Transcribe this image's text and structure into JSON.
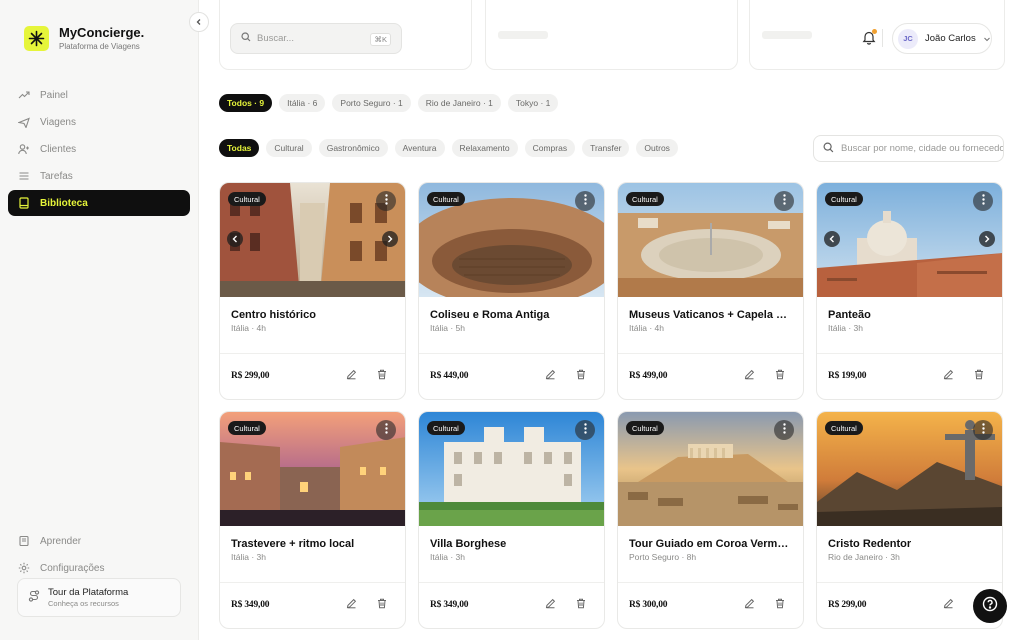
{
  "brand": {
    "name": "MyConcierge.",
    "subtitle": "Plataforma de Viagens"
  },
  "colors": {
    "accent": "#e6f53a",
    "dark": "#0f0f0f"
  },
  "nav": [
    {
      "id": "painel",
      "label": "Painel",
      "icon": "trend-icon"
    },
    {
      "id": "viagens",
      "label": "Viagens",
      "icon": "plane-icon"
    },
    {
      "id": "clientes",
      "label": "Clientes",
      "icon": "user-plus-icon"
    },
    {
      "id": "tarefas",
      "label": "Tarefas",
      "icon": "list-icon"
    },
    {
      "id": "biblioteca",
      "label": "Biblioteca",
      "icon": "book-icon",
      "active": true
    }
  ],
  "bottom_nav": [
    {
      "id": "aprender",
      "label": "Aprender",
      "icon": "book-open-icon"
    },
    {
      "id": "configuracoes",
      "label": "Configurações",
      "icon": "gear-icon"
    }
  ],
  "tour": {
    "title": "Tour da Plataforma",
    "subtitle": "Conheça os recursos"
  },
  "search": {
    "placeholder": "Buscar...",
    "shortcut": "⌘K"
  },
  "user": {
    "initials": "JC",
    "name": "João Carlos"
  },
  "destination_chips": [
    "Todos · 9",
    "Itália · 6",
    "Porto Seguro · 1",
    "Rio de Janeiro · 1",
    "Tokyo · 1"
  ],
  "category_chips": [
    "Todas",
    "Cultural",
    "Gastronômico",
    "Aventura",
    "Relaxamento",
    "Compras",
    "Transfer",
    "Outros"
  ],
  "card_search": {
    "placeholder": "Buscar por nome, cidade ou fornecedor"
  },
  "cards": [
    {
      "badge": "Cultural",
      "title": "Centro histórico",
      "sub": "Itália · 4h",
      "price": "R$ 299,00",
      "scene": "street"
    },
    {
      "badge": "Cultural",
      "title": "Coliseu e Roma Antiga",
      "sub": "Itália · 5h",
      "price": "R$ 449,00",
      "scene": "colosseum"
    },
    {
      "badge": "Cultural",
      "title": "Museus Vaticanos + Capela Sistina",
      "sub": "Itália · 4h",
      "price": "R$ 499,00",
      "scene": "vatican"
    },
    {
      "badge": "Cultural",
      "title": "Panteão",
      "sub": "Itália · 3h",
      "price": "R$ 199,00",
      "scene": "pantheon"
    },
    {
      "badge": "Cultural",
      "title": "Trastevere + ritmo local",
      "sub": "Itália · 3h",
      "price": "R$ 349,00",
      "scene": "trastevere"
    },
    {
      "badge": "Cultural",
      "title": "Villa Borghese",
      "sub": "Itália · 3h",
      "price": "R$ 349,00",
      "scene": "villa"
    },
    {
      "badge": "Cultural",
      "title": "Tour Guiado em Coroa Vermelha",
      "sub": "Porto Seguro · 8h",
      "price": "R$ 300,00",
      "scene": "acropolis"
    },
    {
      "badge": "Cultural",
      "title": "Cristo Redentor",
      "sub": "Rio de Janeiro · 3h",
      "price": "R$ 299,00",
      "scene": "christ"
    }
  ]
}
